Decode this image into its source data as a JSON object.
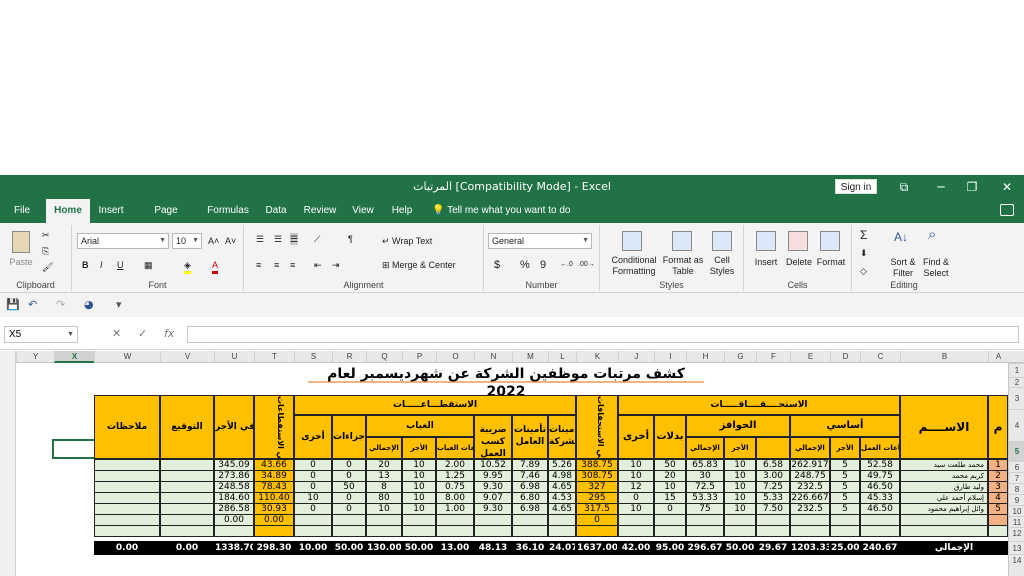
{
  "window": {
    "title": "المرتبات  [Compatibility Mode]  -  Excel",
    "signin": "Sign in",
    "controls": [
      "⧉",
      "─",
      "❐",
      "✕"
    ]
  },
  "tabs": [
    "File",
    "Home",
    "Insert",
    "Page Layout",
    "Formulas",
    "Data",
    "Review",
    "View",
    "Help"
  ],
  "tellme": "Tell me what you want to do",
  "ribbon": {
    "clipboard": {
      "paste": "Paste",
      "label": "Clipboard"
    },
    "font": {
      "name": "Arial",
      "size": "10",
      "bold": "B",
      "italic": "I",
      "underline": "U",
      "label": "Font"
    },
    "alignment": {
      "wrap": "Wrap Text",
      "merge": "Merge & Center",
      "label": "Alignment"
    },
    "number": {
      "format": "General",
      "currency": "$",
      "percent": "%",
      "comma": "9",
      "label": "Number"
    },
    "styles": {
      "conditional": "Conditional Formatting",
      "format_table": "Format as Table",
      "cell_styles": "Cell Styles",
      "label": "Styles"
    },
    "cells": {
      "insert": "Insert",
      "delete": "Delete",
      "format": "Format",
      "label": "Cells"
    },
    "editing": {
      "sort": "Sort & Filter",
      "find": "Find & Select",
      "label": "Editing"
    }
  },
  "formula_bar": {
    "name_box": "X5",
    "cancel": "✕",
    "enter": "✓",
    "fx": "fx",
    "value": ""
  },
  "columns": [
    "Y",
    "X",
    "W",
    "V",
    "U",
    "T",
    "S",
    "R",
    "Q",
    "P",
    "O",
    "N",
    "M",
    "L",
    "K",
    "J",
    "I",
    "H",
    "G",
    "F",
    "E",
    "D",
    "C",
    "B",
    "A"
  ],
  "selected_column": "X",
  "rows": [
    "1",
    "2",
    "3",
    "4",
    "5",
    "6",
    "7",
    "8",
    "9",
    "10",
    "11",
    "12",
    "13",
    "14"
  ],
  "selected_row": "5",
  "sheet": {
    "title": "كشف مرتبات موظفين الشركة عن شهرديسمبر لعام 2022",
    "headers": {
      "m": "م",
      "name": "الاســــم",
      "entitlements": "الاستحــــقــــاقـــــات",
      "basic": "أساسي",
      "incentives": "الحوافز",
      "allowances": "بدلات",
      "other_ent": "أخرى",
      "total_ent": "إجمالي الاستحقاقات",
      "deductions": "الاستقطـــاعـــــات",
      "ins_company": "تأمينات الشركة",
      "ins_worker": "تأمينات العامل",
      "tax": "ضريبة كسب العمل",
      "absence": "الغياب",
      "penalties": "جزاءات",
      "other_ded": "أخرى",
      "total_ded": "إجمالي الاستقطاعات",
      "net": "صافي الأجر",
      "signature": "التوقيع",
      "notes": "ملاحظات",
      "work_hours": "ساعات العمل",
      "wage": "الأجر",
      "total": "الإجمالي",
      "abs_hours": "ساعات الغياب",
      "abs_wage": "الأجر",
      "abs_total": "الإجمالي",
      "inc_total": "الإجمالي",
      "inc_wage": "الأجر",
      "inc_hours": ""
    },
    "employees": [
      {
        "m": "1",
        "name": "محمد طلعت سيد",
        "hours": "52.58",
        "wage": "5",
        "basic_total": "262.917",
        "inc_a": "6.58",
        "inc_b": "10",
        "inc_total": "65.83",
        "allow": "50",
        "other": "10",
        "total_ent": "388.75",
        "ins_co": "5.26",
        "ins_w": "7.89",
        "tax": "10.52",
        "abs_h": "2.00",
        "abs_w": "10",
        "abs_t": "20",
        "pen": "0",
        "oth_d": "0",
        "total_ded": "43.66",
        "net": "345.09"
      },
      {
        "m": "2",
        "name": "كريم محمد",
        "hours": "49.75",
        "wage": "5",
        "basic_total": "248.75",
        "inc_a": "3.00",
        "inc_b": "10",
        "inc_total": "30",
        "allow": "20",
        "other": "10",
        "total_ent": "308.75",
        "ins_co": "4.98",
        "ins_w": "7.46",
        "tax": "9.95",
        "abs_h": "1.25",
        "abs_w": "10",
        "abs_t": "13",
        "pen": "0",
        "oth_d": "0",
        "total_ded": "34.89",
        "net": "273.86"
      },
      {
        "m": "3",
        "name": "وليد طارق",
        "hours": "46.50",
        "wage": "5",
        "basic_total": "232.5",
        "inc_a": "7.25",
        "inc_b": "10",
        "inc_total": "72.5",
        "allow": "10",
        "other": "12",
        "total_ent": "327",
        "ins_co": "4.65",
        "ins_w": "6.98",
        "tax": "9.30",
        "abs_h": "0.75",
        "abs_w": "10",
        "abs_t": "8",
        "pen": "50",
        "oth_d": "0",
        "total_ded": "78.43",
        "net": "248.58"
      },
      {
        "m": "4",
        "name": "إسلام أحمد علي",
        "hours": "45.33",
        "wage": "5",
        "basic_total": "226.667",
        "inc_a": "5.33",
        "inc_b": "10",
        "inc_total": "53.33",
        "allow": "15",
        "other": "0",
        "total_ent": "295",
        "ins_co": "4.53",
        "ins_w": "6.80",
        "tax": "9.07",
        "abs_h": "8.00",
        "abs_w": "10",
        "abs_t": "80",
        "pen": "0",
        "oth_d": "10",
        "total_ded": "110.40",
        "net": "184.60"
      },
      {
        "m": "5",
        "name": "وائل إبراهيم محمود",
        "hours": "46.50",
        "wage": "5",
        "basic_total": "232.5",
        "inc_a": "7.50",
        "inc_b": "10",
        "inc_total": "75",
        "allow": "0",
        "other": "10",
        "total_ent": "317.5",
        "ins_co": "4.65",
        "ins_w": "6.98",
        "tax": "9.30",
        "abs_h": "1.00",
        "abs_w": "10",
        "abs_t": "10",
        "pen": "0",
        "oth_d": "0",
        "total_ded": "30.93",
        "net": "286.58"
      }
    ],
    "row11": {
      "total_ent": "0",
      "total_ded": "0.00",
      "net": "0.00"
    },
    "totals": {
      "label": "الإجمالي",
      "hours": "240.67",
      "wage": "25.00",
      "basic_total": "1203.33",
      "inc_a": "29.67",
      "inc_b": "50.00",
      "inc_total": "296.67",
      "allow": "95.00",
      "other": "42.00",
      "total_ent": "1637.00",
      "ins_co": "24.07",
      "ins_w": "36.10",
      "tax": "48.13",
      "abs_h": "13.00",
      "abs_w": "50.00",
      "abs_t": "130.00",
      "pen": "50.00",
      "oth_d": "10.00",
      "total_ded": "298.30",
      "net": "1338.70",
      "signature": "0.00",
      "notes": "0.00"
    }
  }
}
